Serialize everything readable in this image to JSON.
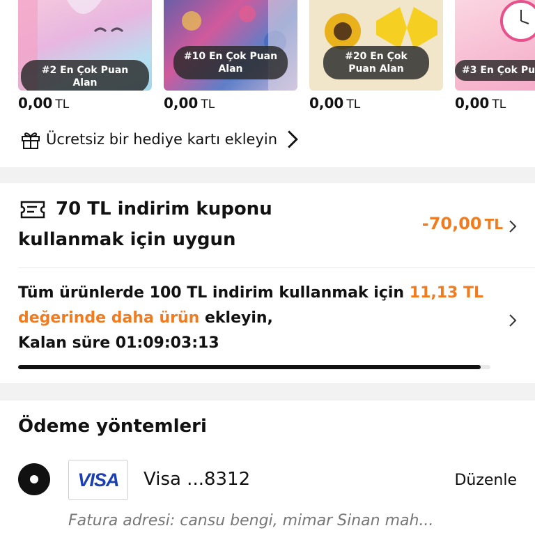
{
  "products": [
    {
      "badge": "#2 En Çok Puan Alan",
      "price": "0,00",
      "currency": "TL",
      "image": "unicorn-bag-image"
    },
    {
      "badge": "#10 En Çok Puan Alan",
      "price": "0,00",
      "currency": "TL",
      "image": "dress-image"
    },
    {
      "badge": "#20 En Çok Puan Alan",
      "price": "0,00",
      "currency": "TL",
      "image": "sunflower-accessory-image"
    },
    {
      "badge": "#3 En Çok Pu",
      "price": "0,00",
      "currency": "TL",
      "image": "unicorn-clock-image"
    }
  ],
  "gift_card": {
    "label": "Ücretsiz bir hediye kartı ekleyin",
    "icon": "gift-icon"
  },
  "coupon": {
    "line1": "70 TL indirim kuponu",
    "line2": "kullanmak için uygun",
    "amount": "-70,00",
    "currency": "TL",
    "icon": "ticket-icon"
  },
  "promo": {
    "part1": "Tüm ürünlerde 100 TL indirim kullanmak için ",
    "highlight": "11,13 TL değerinde daha ürün",
    "part2": " ekleyin,",
    "remaining": "Kalan süre 01:09:03:13",
    "progress": 0.98
  },
  "payment": {
    "title": "Ödeme yöntemleri",
    "card_brand": "VISA",
    "card_label": "Visa ...8312",
    "edit_label": "Düzenle",
    "billing": "Fatura adresi: cansu bengi, mimar Sinan mah..."
  },
  "colors": {
    "accent": "#f07c1f",
    "text": "#111111",
    "muted": "#777777",
    "visa": "#1a3fb3"
  }
}
